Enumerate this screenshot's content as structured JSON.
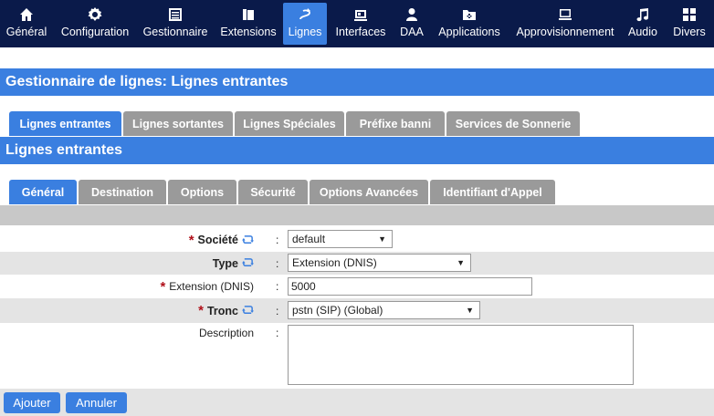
{
  "nav": {
    "items": [
      {
        "label": "Général",
        "icon": "home-icon"
      },
      {
        "label": "Configuration",
        "icon": "gear-icon"
      },
      {
        "label": "Gestionnaire",
        "icon": "list-icon"
      },
      {
        "label": "Extensions",
        "icon": "phone-icon"
      },
      {
        "label": "Lignes",
        "icon": "route-icon"
      },
      {
        "label": "Interfaces",
        "icon": "interface-icon"
      },
      {
        "label": "DAA",
        "icon": "user-icon"
      },
      {
        "label": "Applications",
        "icon": "folder-icon"
      },
      {
        "label": "Approvisionnement",
        "icon": "provision-icon"
      },
      {
        "label": "Audio",
        "icon": "music-icon"
      },
      {
        "label": "Divers",
        "icon": "grid-icon"
      }
    ],
    "active": "Lignes"
  },
  "page_title": "Gestionnaire de lignes:  Lignes entrantes",
  "tabs_main": [
    "Lignes entrantes",
    "Lignes sortantes",
    "Lignes Spéciales",
    "Préfixe banni",
    "Services de Sonnerie"
  ],
  "section_title": "Lignes entrantes",
  "tabs_sub": [
    "Général",
    "Destination",
    "Options",
    "Sécurité",
    "Options Avancées",
    "Identifiant d'Appel"
  ],
  "form": {
    "societe": {
      "label": "Société",
      "value": "default"
    },
    "type": {
      "label": "Type",
      "value": "Extension (DNIS)"
    },
    "extension": {
      "label": "Extension (DNIS)",
      "value": "5000"
    },
    "tronc": {
      "label": "Tronc",
      "value": "pstn (SIP) (Global)"
    },
    "description": {
      "label": "Description",
      "value": ""
    },
    "colon": ":",
    "required_mark": "*"
  },
  "buttons": {
    "add": "Ajouter",
    "cancel": "Annuler"
  },
  "colors": {
    "nav_bg": "#0a1a4a",
    "accent": "#3a7fe0",
    "tab_inactive": "#9a9a9a",
    "required": "#b0101a"
  }
}
